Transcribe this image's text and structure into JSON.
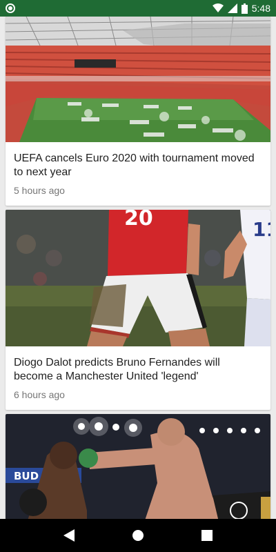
{
  "status_bar": {
    "time": "5:48",
    "icons": [
      "wifi-icon",
      "signal-icon",
      "battery-icon"
    ]
  },
  "articles": [
    {
      "title": "UEFA cancels Euro 2020 with tournament moved to next year",
      "time": "5 hours ago",
      "image": "stadium-photo"
    },
    {
      "title": "Diogo Dalot predicts Bruno Fernandes will become a Manchester United 'legend'",
      "time": "6 hours ago",
      "image": "football-player-photo"
    },
    {
      "title": "",
      "time": "",
      "image": "boxing-photo"
    }
  ],
  "nav_bar": {
    "buttons": [
      "back-icon",
      "home-icon",
      "recents-icon"
    ]
  },
  "colors": {
    "status_bar": "#1f6b34",
    "background": "#ebebeb",
    "card": "#ffffff",
    "title_text": "#212121",
    "time_text": "#757575"
  }
}
